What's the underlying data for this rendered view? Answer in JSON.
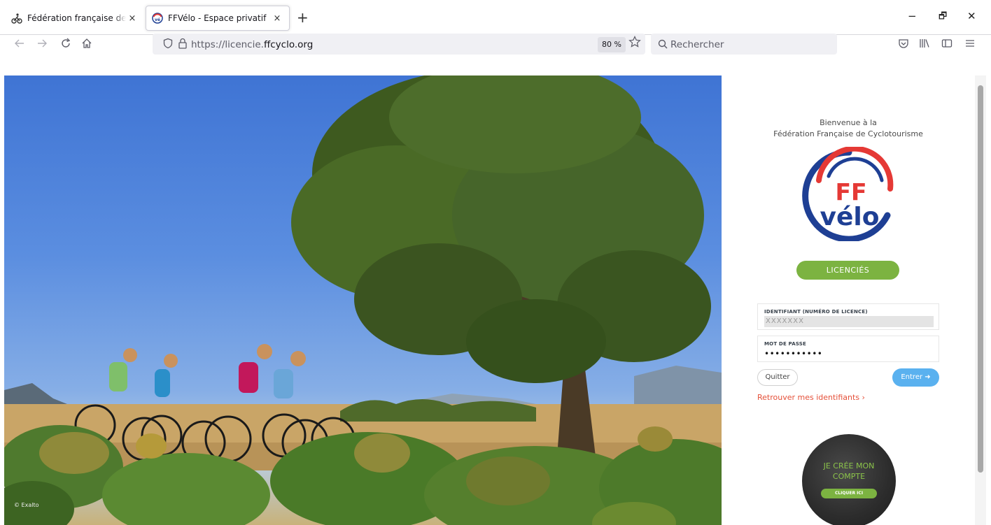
{
  "browser": {
    "tabs": [
      {
        "title": "Fédération française de cyclotourisme",
        "active": false,
        "icon": "cyclist-icon"
      },
      {
        "title": "FFVélo - Espace privatif",
        "active": true,
        "icon": "ffvelo-logo-icon"
      }
    ],
    "close_glyph": "×",
    "new_tab_glyph": "+",
    "address": {
      "prefix": "https://licencie.",
      "domain": "ffcyclo.org"
    },
    "zoom": "80 %",
    "search_placeholder": "Rechercher",
    "window_controls": {
      "minimize": "−",
      "maximize": "🗗",
      "close": "✕"
    }
  },
  "hero": {
    "description": "",
    "copyright": "© Exalto"
  },
  "login": {
    "welcome_line1": "Bienvenue à la",
    "welcome_line2": "Fédération Française de Cyclotourisme",
    "logo": {
      "ff": "FF",
      "velo": "vélo",
      "colors": {
        "red": "#e53935",
        "blue": "#1e3f94"
      }
    },
    "licencies_button": "LICENCIÉS",
    "id_label": "IDENTIFIANT (NUMÉRO DE LICENCE)",
    "id_value": "XXXXXXX",
    "password_label": "MOT DE PASSE",
    "password_value": "•••••••••••",
    "quit_button": "Quitter",
    "enter_button": "Entrer ➜",
    "recover_link": "Retrouver mes identifiants ›",
    "create_account_line1": "JE CRÉE MON",
    "create_account_line2": "COMPTE",
    "create_account_button": "CLIQUER ICI"
  },
  "colors": {
    "licencies_green": "#7cb341",
    "enter_blue": "#5ab1ef",
    "recover_red": "#e55039"
  }
}
